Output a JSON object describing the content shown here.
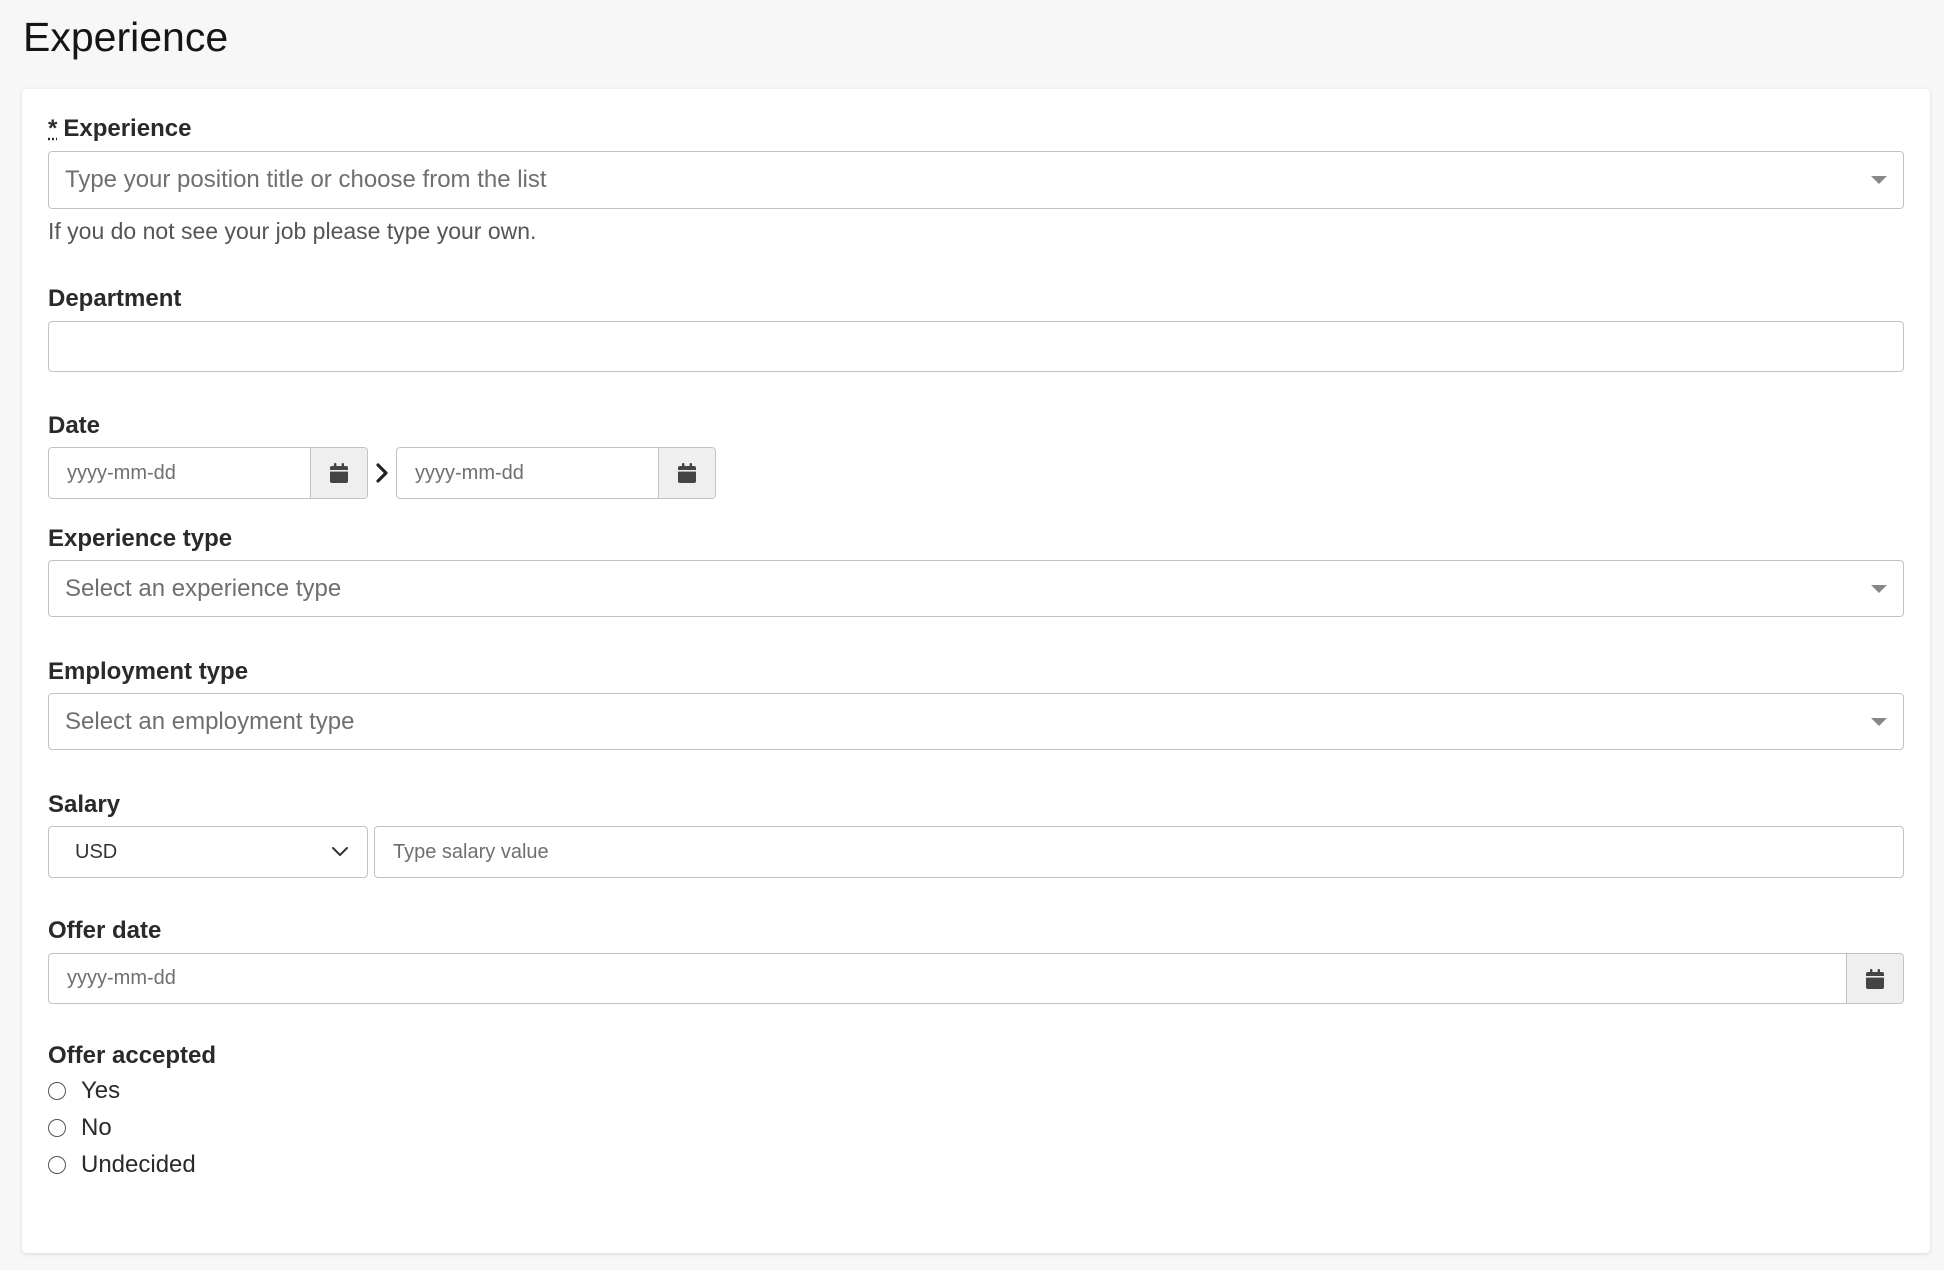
{
  "page": {
    "title": "Experience"
  },
  "form": {
    "experience": {
      "required_mark": "*",
      "label": "Experience",
      "placeholder": "Type your position title or choose from the list",
      "value": "",
      "help": "If you do not see your job please type your own."
    },
    "department": {
      "label": "Department",
      "value": ""
    },
    "date": {
      "label": "Date",
      "start_placeholder": "yyyy-mm-dd",
      "end_placeholder": "yyyy-mm-dd"
    },
    "experience_type": {
      "label": "Experience type",
      "placeholder": "Select an experience type"
    },
    "employment_type": {
      "label": "Employment type",
      "placeholder": "Select an employment type"
    },
    "salary": {
      "label": "Salary",
      "currency": "USD",
      "placeholder": "Type salary value"
    },
    "offer_date": {
      "label": "Offer date",
      "placeholder": "yyyy-mm-dd"
    },
    "offer_accepted": {
      "label": "Offer accepted",
      "options": [
        "Yes",
        "No",
        "Undecided"
      ],
      "selected": null
    }
  },
  "icons": {
    "calendar": "calendar-icon",
    "chevron_right": "chevron-right-icon",
    "chevron_down": "chevron-down-icon",
    "caret_down": "caret-down-icon"
  },
  "colors": {
    "background": "#f7f7f7",
    "card": "#ffffff",
    "border": "#c3c3c3",
    "icon": "#444444",
    "addon": "#efefef"
  }
}
